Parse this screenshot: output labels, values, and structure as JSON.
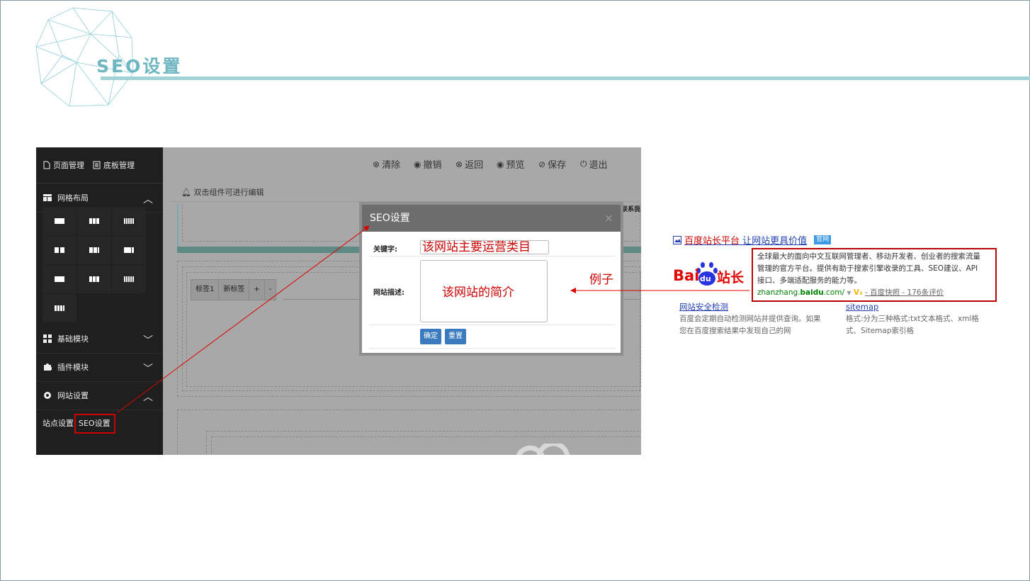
{
  "slide": {
    "title": "SEO设置"
  },
  "sidebar": {
    "top_tabs": [
      "页面管理",
      "底板管理"
    ],
    "sections": [
      {
        "label": "网格布局",
        "chevron": "up"
      },
      {
        "label": "基础模块",
        "chevron": "down"
      },
      {
        "label": "插件模块",
        "chevron": "down"
      },
      {
        "label": "网站设置",
        "chevron": "up"
      }
    ],
    "sub_items": [
      "站点设置",
      "SEO设置"
    ]
  },
  "toolbar": {
    "buttons": [
      {
        "glyph": "⊗",
        "label": "清除"
      },
      {
        "glyph": "◉",
        "label": "撤销"
      },
      {
        "glyph": "⊗",
        "label": "返回"
      },
      {
        "glyph": "◉",
        "label": "预览"
      },
      {
        "glyph": "⊘",
        "label": "保存"
      },
      {
        "glyph": "⏻",
        "label": "退出"
      }
    ]
  },
  "editor": {
    "hint": "双击组件可进行编辑",
    "partial_text": "联系我",
    "tabs": [
      "标签1",
      "新标签",
      "+",
      "-"
    ]
  },
  "modal": {
    "title": "SEO设置",
    "close": "×",
    "keyword_label": "关键字:",
    "keyword_value": "该网站主要运营类目",
    "desc_label": "网站描述:",
    "desc_value": "该网站的简介",
    "confirm_label": "确定",
    "reset_label": "重置"
  },
  "example": {
    "label": "例子",
    "result_title_red": "百度站长平台",
    "result_title_rest": " 让网站更具价值",
    "badge": "官网",
    "logo_text_left": "Bai",
    "logo_text_mid": "du",
    "logo_text_right": "站长",
    "snippet_line1": "全球最大的面向中文互联网管理者、移动开发者、创业者的搜索流量",
    "snippet_line2": "管理的官方平台。提供有助于搜索引擎收录的工具、SEO建议、API",
    "snippet_line3": "接口、多端适配服务的能力等。",
    "url_prefix": "zhanzhang.",
    "url_bold": "baidu",
    "url_suffix": ".com/",
    "url_extra": "- 百度快照 - 176条评价",
    "col1_title": "网站安全检测",
    "col1_line1": "百度会定期自动检测网站并提供查询。如果",
    "col1_line2": "您在百度搜索结果中发现自己的网",
    "col2_title": "sitemap",
    "col2_line1": "格式:分为三种格式:txt文本格式、xml格",
    "col2_line2": "式、Sitemap索引格"
  },
  "colors": {
    "accent_teal": "#6fb7c0",
    "annotation_red": "#cc0000",
    "baidu_blue": "#2440b3"
  }
}
